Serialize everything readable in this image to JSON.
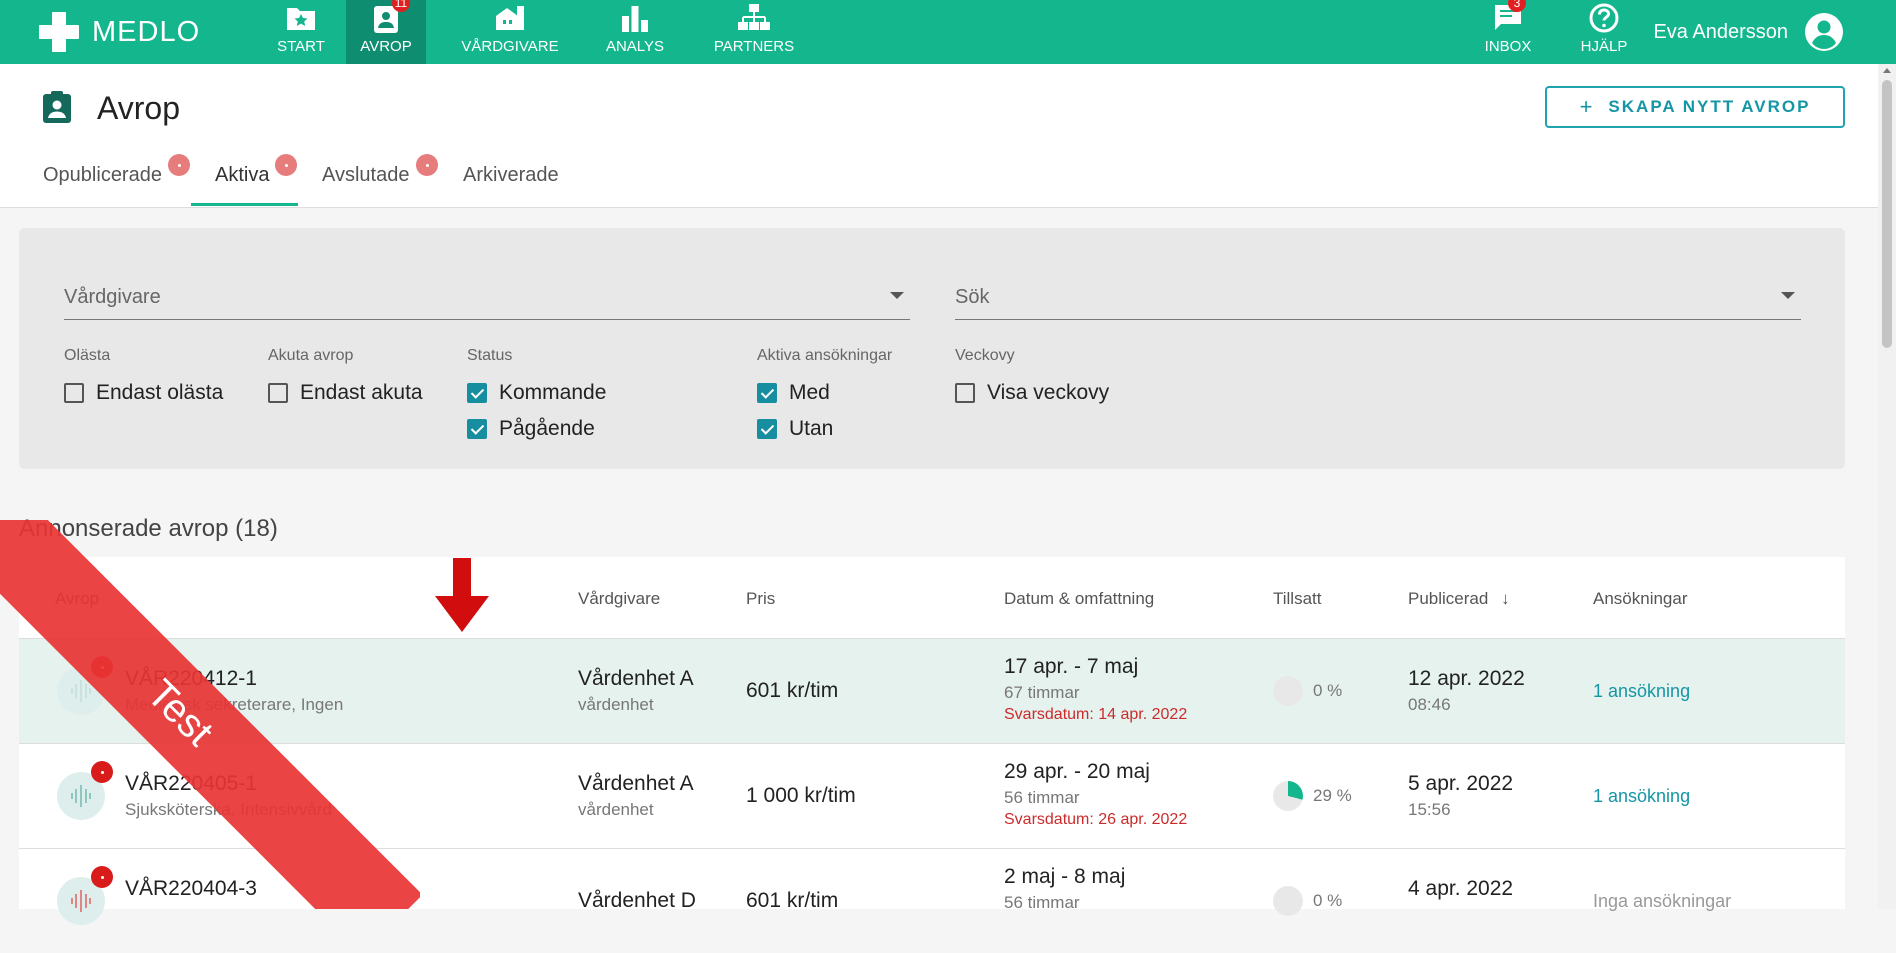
{
  "app": {
    "name": "MEDLO"
  },
  "nav": [
    {
      "label": "START",
      "icon": "folder-star-icon"
    },
    {
      "label": "AVROP",
      "icon": "clipboard-user-icon",
      "badge": "11"
    },
    {
      "label": "VÅRDGIVARE",
      "icon": "buildings-icon"
    },
    {
      "label": "ANALYS",
      "icon": "bar-chart-icon"
    },
    {
      "label": "PARTNERS",
      "icon": "org-chart-icon"
    }
  ],
  "right_nav": [
    {
      "label": "INBOX",
      "icon": "chat-icon",
      "badge": "3"
    },
    {
      "label": "HJÄLP",
      "icon": "help-circle-icon"
    }
  ],
  "user": {
    "name": "Eva Andersson"
  },
  "page": {
    "title": "Avrop",
    "create_button": "SKAPA NYTT AVROP",
    "create_icon": "+"
  },
  "tabs": [
    "Opublicerade",
    "Aktiva",
    "Avslutade",
    "Arkiverade"
  ],
  "filters": {
    "vardgivare_placeholder": "Vårdgivare",
    "search_placeholder": "Sök",
    "groups": [
      {
        "label": "Olästa",
        "options": [
          {
            "label": "Endast olästa",
            "checked": false
          }
        ]
      },
      {
        "label": "Akuta avrop",
        "options": [
          {
            "label": "Endast akuta",
            "checked": false
          }
        ]
      },
      {
        "label": "Status",
        "options": [
          {
            "label": "Kommande",
            "checked": true
          },
          {
            "label": "Pågående",
            "checked": true
          }
        ]
      },
      {
        "label": "Aktiva ansökningar",
        "options": [
          {
            "label": "Med",
            "checked": true
          },
          {
            "label": "Utan",
            "checked": true
          }
        ]
      },
      {
        "label": "Veckovy",
        "options": [
          {
            "label": "Visa veckovy",
            "checked": false
          }
        ]
      }
    ]
  },
  "section": {
    "title": "Annonserade avrop (18)"
  },
  "table": {
    "headers": [
      "Avrop",
      "Vårdgivare",
      "Pris",
      "Datum & omfattning",
      "Tillsatt",
      "Publicerad",
      "Ansökningar"
    ],
    "rows": [
      {
        "id": "VÅR220412-1",
        "role": "Medicinsk sekreterare, Ingen",
        "provider": "Vårdenhet A",
        "provider_sub": "vårdenhet",
        "price": "601 kr/tim",
        "dates": "17 apr. - 7 maj",
        "hours": "67 timmar",
        "deadline": "Svarsdatum: 14 apr. 2022",
        "filled_pct": "0 %",
        "filled_value": 0,
        "published_date": "12 apr. 2022",
        "published_time": "08:46",
        "applications": "1 ansökning"
      },
      {
        "id": "VÅR220405-1",
        "role": "Sjuksköterska, Intensivvård",
        "provider": "Vårdenhet A",
        "provider_sub": "vårdenhet",
        "price": "1 000 kr/tim",
        "dates": "29 apr. - 20 maj",
        "hours": "56 timmar",
        "deadline": "Svarsdatum: 26 apr. 2022",
        "filled_pct": "29 %",
        "filled_value": 29,
        "published_date": "5 apr. 2022",
        "published_time": "15:56",
        "applications": "1 ansökning"
      },
      {
        "id": "VÅR220404-3",
        "role": "",
        "provider": "Vårdenhet D",
        "provider_sub": "",
        "price": "601 kr/tim",
        "dates": "2 maj - 8 maj",
        "hours": "56 timmar",
        "deadline": "",
        "filled_pct": "0 %",
        "filled_value": 0,
        "published_date": "4 apr. 2022",
        "published_time": "",
        "applications": "Inga ansökningar"
      }
    ]
  },
  "ribbon": {
    "text": "Test"
  },
  "colors": {
    "primary": "#14b68e",
    "accent": "#1596a5",
    "danger": "#d81b1b"
  }
}
